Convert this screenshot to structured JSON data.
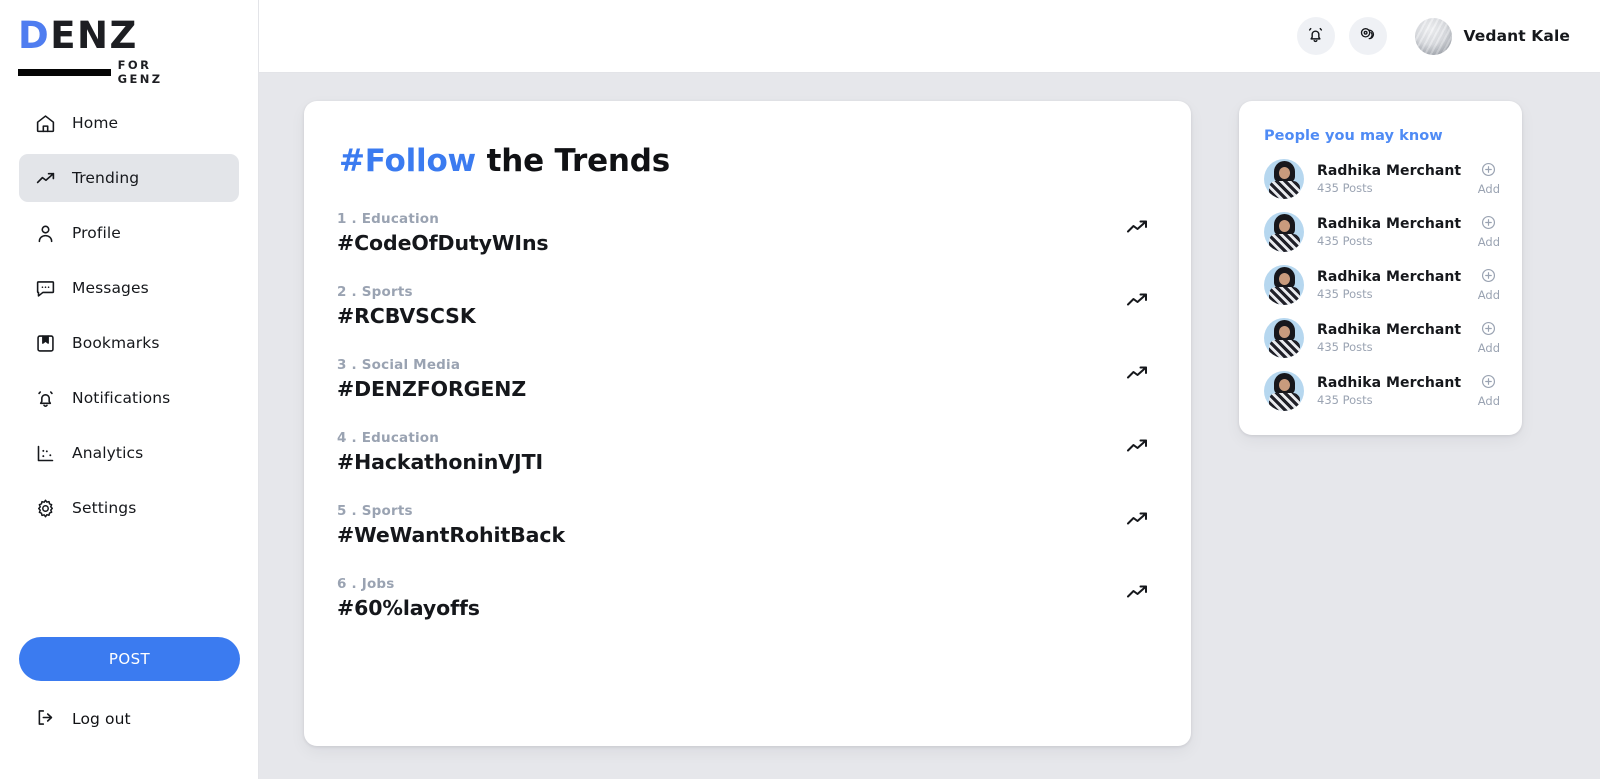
{
  "brand": {
    "logo_main_accent": "D",
    "logo_main_rest": "ENZ",
    "logo_sub": "FOR GENZ",
    "accent_color": "#4f7df0"
  },
  "sidebar": {
    "items": [
      {
        "label": "Home",
        "icon": "home-icon",
        "active": false
      },
      {
        "label": "Trending",
        "icon": "trending-up-icon",
        "active": true
      },
      {
        "label": "Profile",
        "icon": "user-icon",
        "active": false
      },
      {
        "label": "Messages",
        "icon": "message-icon",
        "active": false
      },
      {
        "label": "Bookmarks",
        "icon": "bookmark-icon",
        "active": false
      },
      {
        "label": "Notifications",
        "icon": "bell-icon",
        "active": false
      },
      {
        "label": "Analytics",
        "icon": "analytics-icon",
        "active": false
      },
      {
        "label": "Settings",
        "icon": "gear-icon",
        "active": false
      }
    ],
    "post_button": "POST",
    "logout": "Log out"
  },
  "topbar": {
    "notifications_icon": "bell-icon",
    "coins_icon": "coins-icon",
    "user_name": "Vedant Kale"
  },
  "trends": {
    "title_accent": "#Follow",
    "title_rest": " the Trends",
    "items": [
      {
        "rank": "1",
        "category": "Education",
        "meta": "1 . Education",
        "hashtag": "#CodeOfDutyWIns"
      },
      {
        "rank": "2",
        "category": "Sports",
        "meta": "2 . Sports",
        "hashtag": "#RCBVSCSK"
      },
      {
        "rank": "3",
        "category": "Social Media",
        "meta": "3 . Social Media",
        "hashtag": "#DENZFORGENZ"
      },
      {
        "rank": "4",
        "category": "Education",
        "meta": "4 . Education",
        "hashtag": "#HackathoninVJTI"
      },
      {
        "rank": "5",
        "category": "Sports",
        "meta": "5 . Sports",
        "hashtag": "#WeWantRohitBack"
      },
      {
        "rank": "6",
        "category": "Jobs",
        "meta": "6 . Jobs",
        "hashtag": "#60%layoffs"
      }
    ]
  },
  "people": {
    "title": "People you may know",
    "add_label": "Add",
    "items": [
      {
        "name": "Radhika Merchant",
        "posts": "435 Posts"
      },
      {
        "name": "Radhika Merchant",
        "posts": "435 Posts"
      },
      {
        "name": "Radhika Merchant",
        "posts": "435 Posts"
      },
      {
        "name": "Radhika Merchant",
        "posts": "435 Posts"
      },
      {
        "name": "Radhika Merchant",
        "posts": "435 Posts"
      }
    ]
  }
}
